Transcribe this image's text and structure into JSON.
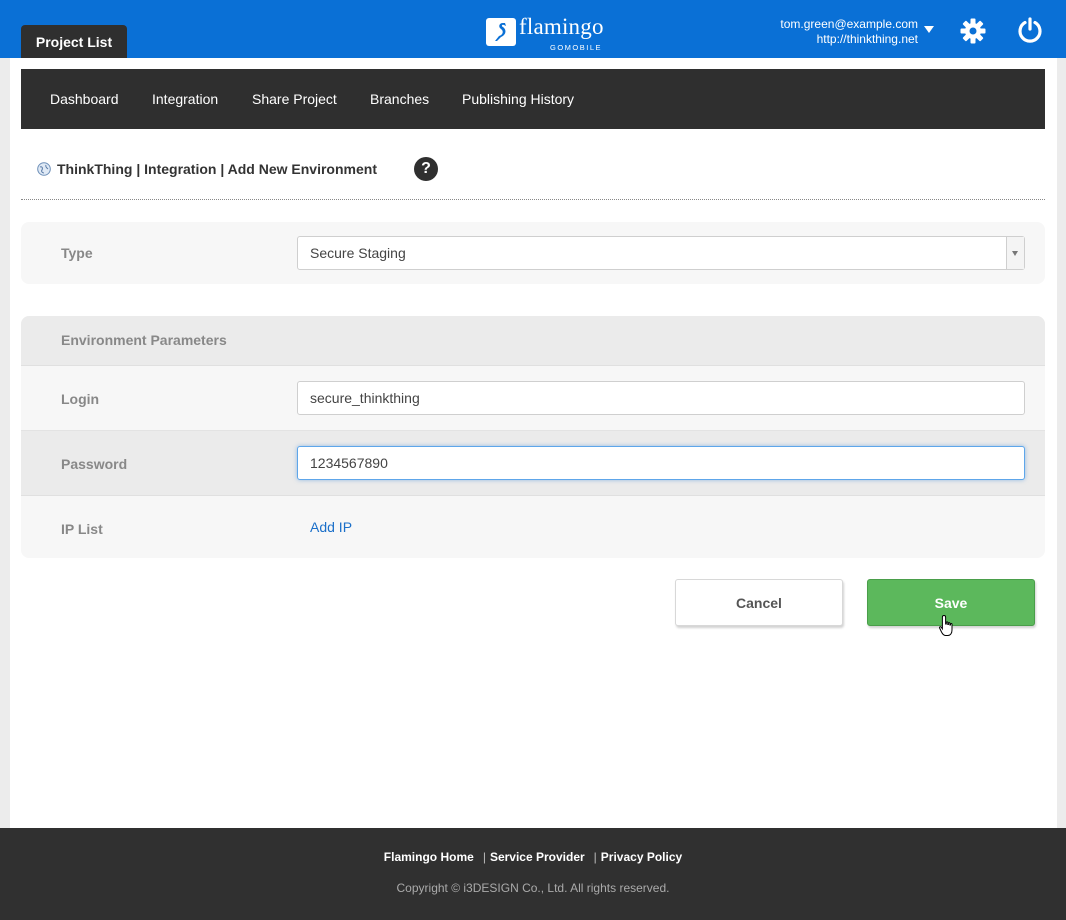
{
  "header": {
    "project_tab": "Project List",
    "logo_text": "flamingo",
    "logo_sub": "GOMOBILE",
    "user_email": "tom.green@example.com",
    "user_url": "http://thinkthing.net",
    "colors": {
      "bar": "#0a70d6",
      "accent": "#5cb85c"
    }
  },
  "subnav": {
    "items": [
      "Dashboard",
      "Integration",
      "Share Project",
      "Branches",
      "Publishing History"
    ]
  },
  "breadcrumb": {
    "text": "ThinkThing | Integration | Add New Environment",
    "help_label": "?"
  },
  "type_panel": {
    "label": "Type",
    "selected": "Secure Staging"
  },
  "env_panel": {
    "title": "Environment Parameters",
    "login_label": "Login",
    "login_value": "secure_thinkthing",
    "password_label": "Password",
    "password_value": "1234567890",
    "ip_label": "IP List",
    "add_ip": "Add IP"
  },
  "actions": {
    "cancel": "Cancel",
    "save": "Save"
  },
  "footer": {
    "links": [
      "Flamingo Home",
      "Service Provider",
      "Privacy Policy"
    ],
    "copyright": "Copyright © i3DESIGN Co., Ltd. All rights reserved."
  }
}
